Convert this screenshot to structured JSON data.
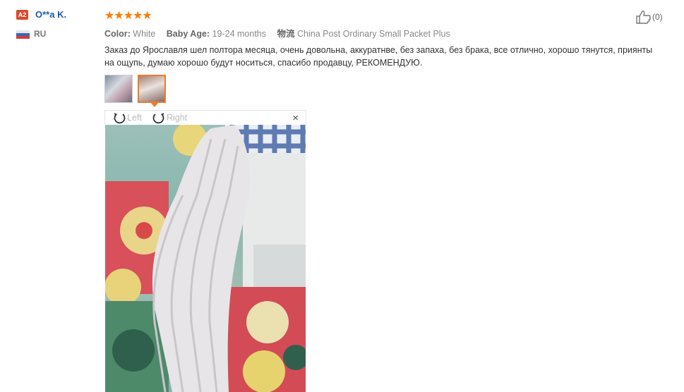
{
  "reviewer": {
    "badge": "A2",
    "name": "O**a K.",
    "country": "RU",
    "flag_colors": [
      "#e6e6e6",
      "#3b64b8",
      "#d63a3a"
    ]
  },
  "rating": {
    "stars": 5,
    "display": "★★★★★",
    "color": "#ff7a00"
  },
  "attributes": [
    {
      "key": "Color:",
      "value": "White"
    },
    {
      "key": "Baby Age:",
      "value": "19-24 months"
    },
    {
      "key": "物流",
      "value": "China Post Ordinary Small Packet Plus"
    }
  ],
  "review_text": "Заказ до Ярославля шел полтора месяца, очень довольна, аккуратнве, без запаха, без брака, все отлично, хорошо тянутся, приянты на ощупь, думаю хорошо будут носиться, спасибо продавцу, РЕКОМЕНДУЮ.",
  "viewer": {
    "rotate_left_label": "Left",
    "rotate_right_label": "Right",
    "close_label": "×"
  },
  "helpful": {
    "count_label": "(0)"
  },
  "colors": {
    "accent": "#f07a2c",
    "link": "#1a5bab"
  }
}
